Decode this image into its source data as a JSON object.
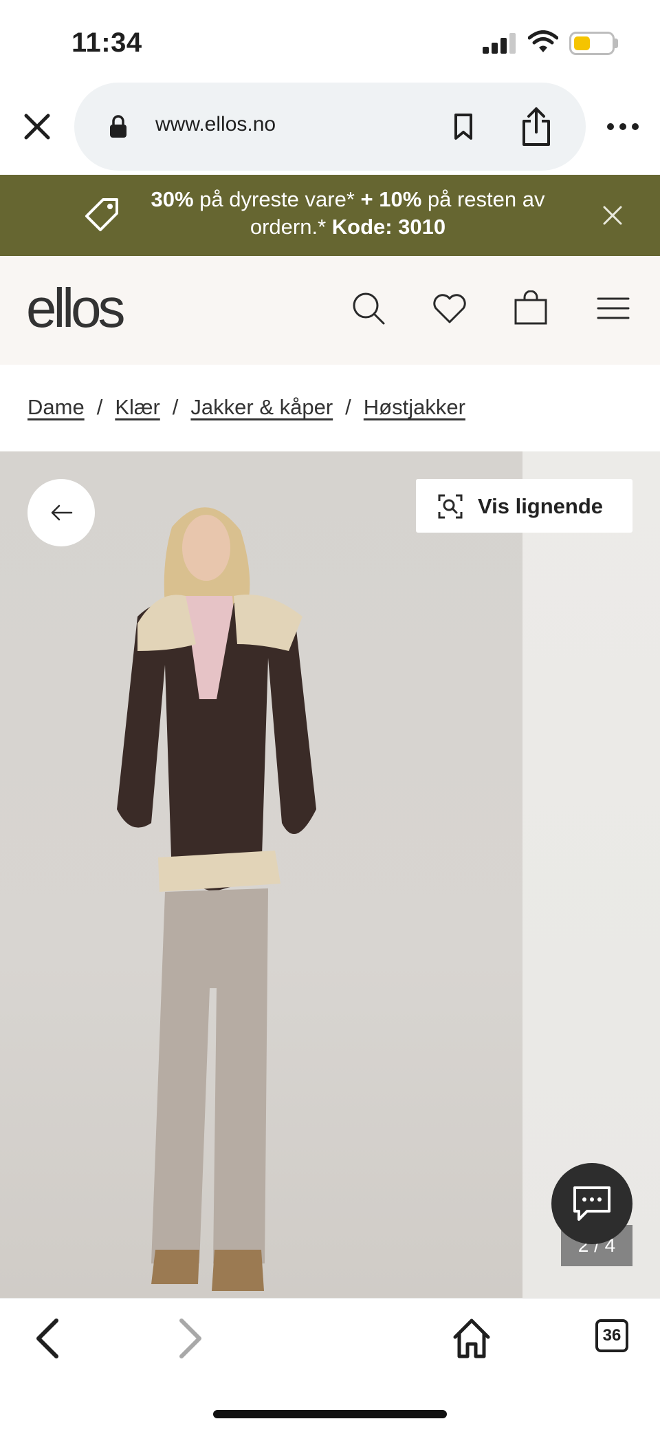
{
  "status_bar": {
    "time": "11:34",
    "battery_level": 0.45,
    "battery_color": "#f5c400"
  },
  "browser": {
    "url": "www.ellos.no",
    "tab_count": "36"
  },
  "promo": {
    "part1_bold": "30%",
    "part2": " på dyreste vare* ",
    "part3_bold": "+ 10%",
    "part4": " på resten av ordern.* ",
    "part5_bold": "Kode: 3010",
    "background": "#666631"
  },
  "header": {
    "logo": "ellos"
  },
  "breadcrumb": {
    "items": [
      "Dame",
      "Klær",
      "Jakker & kåper",
      "Høstjakker"
    ],
    "separator": "/"
  },
  "gallery": {
    "similar_button": "Vis lignende",
    "pager": "2 / 4"
  },
  "icons": [
    "close-icon",
    "lock-icon",
    "bookmark-icon",
    "share-icon",
    "more-icon",
    "tag-icon",
    "search-icon",
    "heart-icon",
    "bag-icon",
    "menu-icon",
    "arrow-left-icon",
    "visual-search-icon",
    "chat-icon",
    "back-icon",
    "forward-icon",
    "home-icon"
  ]
}
